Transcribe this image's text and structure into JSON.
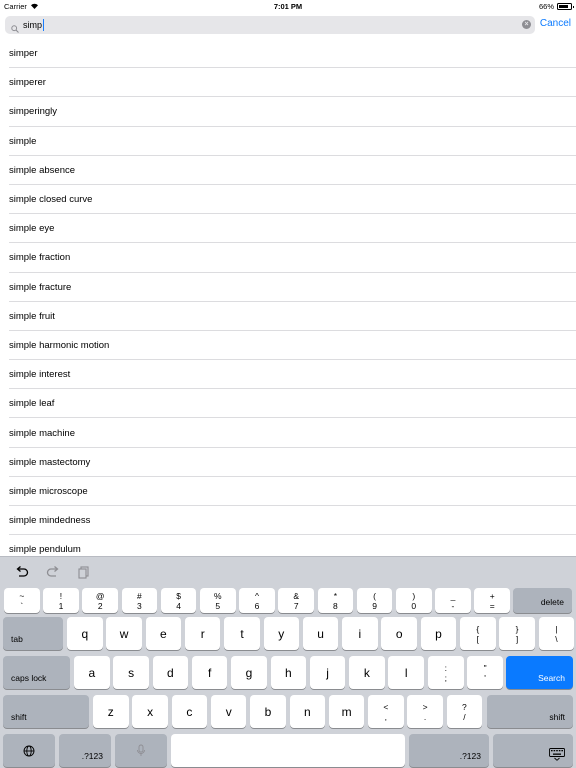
{
  "status": {
    "carrier": "Carrier",
    "time": "7:01 PM",
    "battery": "66%",
    "battery_level": 0.66
  },
  "search": {
    "query": "simp",
    "cancel_label": "Cancel"
  },
  "results": [
    "simper",
    "simperer",
    "simperingly",
    "simple",
    "simple absence",
    "simple closed curve",
    "simple eye",
    "simple fraction",
    "simple fracture",
    "simple fruit",
    "simple harmonic motion",
    "simple interest",
    "simple leaf",
    "simple machine",
    "simple mastectomy",
    "simple microscope",
    "simple mindedness",
    "simple pendulum"
  ],
  "keyboard": {
    "num_row": [
      {
        "top": "~",
        "bottom": "`"
      },
      {
        "top": "!",
        "bottom": "1"
      },
      {
        "top": "@",
        "bottom": "2"
      },
      {
        "top": "#",
        "bottom": "3"
      },
      {
        "top": "$",
        "bottom": "4"
      },
      {
        "top": "%",
        "bottom": "5"
      },
      {
        "top": "^",
        "bottom": "6"
      },
      {
        "top": "&",
        "bottom": "7"
      },
      {
        "top": "*",
        "bottom": "8"
      },
      {
        "top": "(",
        "bottom": "9"
      },
      {
        "top": ")",
        "bottom": "0"
      },
      {
        "top": "_",
        "bottom": "-"
      },
      {
        "top": "+",
        "bottom": "="
      }
    ],
    "delete_label": "delete",
    "tab_label": "tab",
    "row1": [
      "q",
      "w",
      "e",
      "r",
      "t",
      "y",
      "u",
      "i",
      "o",
      "p"
    ],
    "row1_punct": [
      {
        "top": "{",
        "bottom": "["
      },
      {
        "top": "}",
        "bottom": "]"
      },
      {
        "top": "|",
        "bottom": "\\"
      }
    ],
    "caps_label": "caps lock",
    "row2": [
      "a",
      "s",
      "d",
      "f",
      "g",
      "h",
      "j",
      "k",
      "l"
    ],
    "row2_punct": [
      {
        "top": ":",
        "bottom": ";"
      },
      {
        "top": "\"",
        "bottom": "'"
      }
    ],
    "search_label": "Search",
    "shift_label": "shift",
    "row3": [
      "z",
      "x",
      "c",
      "v",
      "b",
      "n",
      "m"
    ],
    "row3_punct": [
      {
        "top": "<",
        "bottom": ","
      },
      {
        "top": ">",
        "bottom": "."
      },
      {
        "top": "?",
        "bottom": "/"
      }
    ],
    "numbers_label": ".?123",
    "accent_color": "#0a7aff"
  }
}
